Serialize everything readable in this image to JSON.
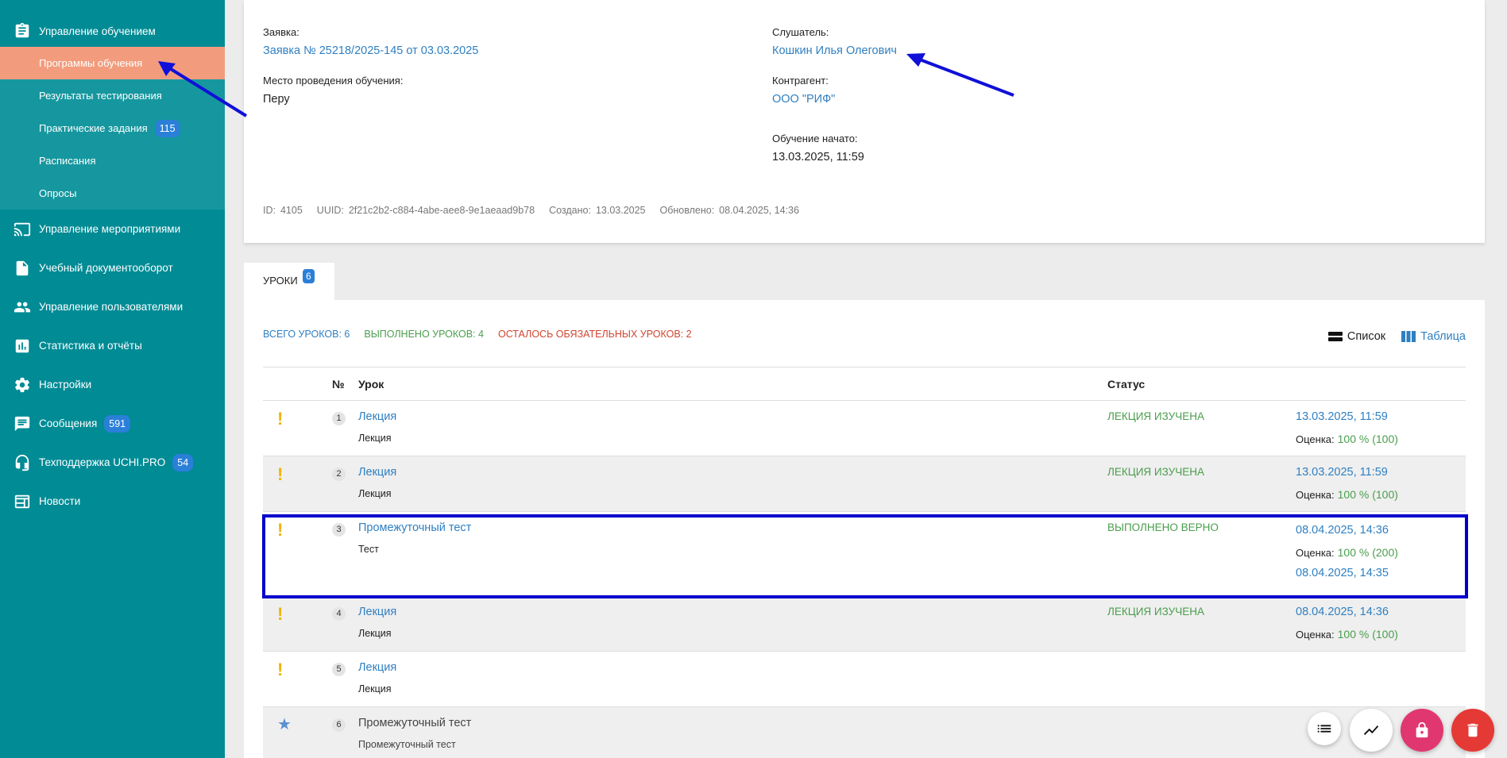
{
  "sidebar": {
    "top_item": "Управление обучением",
    "sub_items": [
      {
        "label": "Программы обучения"
      },
      {
        "label": "Результаты тестирования"
      },
      {
        "label": "Практические задания",
        "badge": "115"
      },
      {
        "label": "Расписания"
      },
      {
        "label": "Опросы"
      }
    ],
    "items": [
      {
        "label": "Управление мероприятиями",
        "icon": "cast-icon"
      },
      {
        "label": "Учебный документооборот",
        "icon": "document-icon"
      },
      {
        "label": "Управление пользователями",
        "icon": "users-icon"
      },
      {
        "label": "Статистика и отчёты",
        "icon": "chart-icon"
      },
      {
        "label": "Настройки",
        "icon": "gear-icon"
      },
      {
        "label": "Сообщения",
        "icon": "message-icon",
        "badge": "591"
      },
      {
        "label": "Техподдержка UCHI.PRO",
        "icon": "support-icon",
        "badge": "54"
      },
      {
        "label": "Новости",
        "icon": "news-icon"
      }
    ]
  },
  "details": {
    "request_label": "Заявка:",
    "request_value": "Заявка № 25218/2025-145 от 03.03.2025",
    "place_label": "Место проведения обучения:",
    "place_value": "Перу",
    "listener_label": "Слушатель:",
    "listener_value": "Кошкин Илья Олегович",
    "contractor_label": "Контрагент:",
    "contractor_value": "ООО \"РИФ\"",
    "started_label": "Обучение начато:",
    "started_value": "13.03.2025, 11:59",
    "meta": {
      "id_label": "ID:",
      "id_value": "4105",
      "uuid_label": "UUID:",
      "uuid_value": "2f21c2b2-c884-4abe-aee8-9e1aeaad9b78",
      "created_label": "Создано:",
      "created_value": "13.03.2025",
      "updated_label": "Обновлено:",
      "updated_value": "08.04.2025, 14:36"
    }
  },
  "tab": {
    "label": "УРОКИ",
    "badge": "6"
  },
  "summary": {
    "total": "ВСЕГО УРОКОВ: 6",
    "done": "ВЫПОЛНЕНО УРОКОВ: 4",
    "left": "ОСТАЛОСЬ ОБЯЗАТЕЛЬНЫХ УРОКОВ: 2"
  },
  "view": {
    "list": "Список",
    "table": "Таблица"
  },
  "table": {
    "headers": {
      "num": "№",
      "lesson": "Урок",
      "status": "Статус"
    },
    "score_label": "Оценка:",
    "rows": [
      {
        "num": "1",
        "title": "Лекция",
        "sub": "Лекция",
        "status": "ЛЕКЦИЯ ИЗУЧЕНА",
        "date": "13.03.2025, 11:59",
        "score": "100 % (100)"
      },
      {
        "num": "2",
        "title": "Лекция",
        "sub": "Лекция",
        "status": "ЛЕКЦИЯ ИЗУЧЕНА",
        "date": "13.03.2025, 11:59",
        "score": "100 % (100)"
      },
      {
        "num": "3",
        "title": "Промежуточный тест",
        "sub": "Тест",
        "status": "ВЫПОЛНЕНО ВЕРНО",
        "date": "08.04.2025, 14:36",
        "score": "100 % (200)",
        "date2": "08.04.2025, 14:35"
      },
      {
        "num": "4",
        "title": "Лекция",
        "sub": "Лекция",
        "status": "ЛЕКЦИЯ ИЗУЧЕНА",
        "date": "08.04.2025, 14:36",
        "score": "100 % (100)"
      },
      {
        "num": "5",
        "title": "Лекция",
        "sub": "Лекция"
      },
      {
        "num": "6",
        "title": "Промежуточный тест",
        "sub": "Промежуточный тест"
      }
    ]
  },
  "colors": {
    "sidebar": "#008b95",
    "active": "#f29c7d",
    "link": "#2f7fc1",
    "success": "#4a9e4d",
    "danger": "#d0452f",
    "highlight": "#0000cc"
  }
}
